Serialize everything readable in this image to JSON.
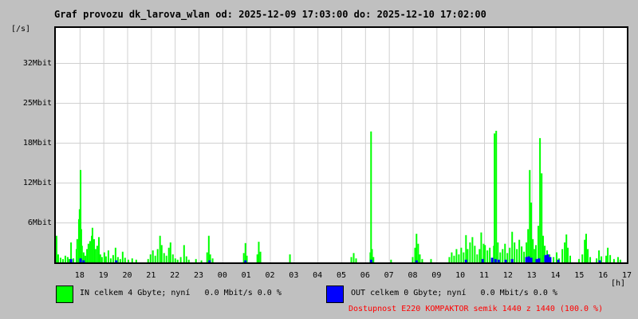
{
  "page": {
    "title": "Graf provozu dk_larova_wlan od: 2025-12-09 17:03:00 do: 2025-12-10 17:02:00",
    "bg_color": "#c0c0c0"
  },
  "axes": {
    "y_unit": "[/s]",
    "x_unit": "[h]"
  },
  "legend": {
    "in": {
      "label": "IN celkem 4 Gbyte; nyní   0.0 Mbit/s 0.0 %",
      "color": "#00ff00"
    },
    "out": {
      "label": "OUT celkem 0 Gbyte; nyní   0.0 Mbit/s 0.0 %",
      "color": "#0000ff"
    }
  },
  "availability": {
    "text": "Dostupnost E220 KOMPAKTOR semik 1440 z 1440 (100.0 %)",
    "color": "#ff0000"
  },
  "chart_data": {
    "type": "area",
    "title": "Graf provozu dk_larova_wlan",
    "period_from": "2025-12-09 17:03:00",
    "period_to": "2025-12-10 17:02:00",
    "xlabel": "[h]",
    "ylabel": "[/s]",
    "grid": true,
    "legend_position": "bottom",
    "x_tick_labels": [
      "18",
      "19",
      "20",
      "21",
      "22",
      "23",
      "00",
      "01",
      "02",
      "03",
      "04",
      "05",
      "06",
      "07",
      "08",
      "09",
      "10",
      "11",
      "12",
      "13",
      "14",
      "15",
      "16",
      "17"
    ],
    "y_tick_labels": [
      "6Mbit",
      "12Mbit",
      "18Mbit",
      "25Mbit",
      "32Mbit"
    ],
    "y_tick_values_mbit": [
      6,
      12,
      18,
      25,
      32
    ],
    "ylim_mbit": [
      0,
      35.3
    ],
    "x_hours_from_17_00": [
      0,
      24
    ],
    "colors": {
      "in": "#00ff00",
      "out": "#0000ff",
      "grid": "#d0d0d0",
      "plot_bg": "#ffffff",
      "frame": "#000000"
    },
    "series": [
      {
        "name": "IN",
        "unit": "Mbit/s",
        "style": "spike-fill",
        "points": [
          [
            0.03,
            4.0
          ],
          [
            0.1,
            1.2
          ],
          [
            0.2,
            0.7
          ],
          [
            0.3,
            0.5
          ],
          [
            0.4,
            1.0
          ],
          [
            0.5,
            0.8
          ],
          [
            0.57,
            0.5
          ],
          [
            0.64,
            3.0
          ],
          [
            0.74,
            0.6
          ],
          [
            0.87,
            2.0
          ],
          [
            0.9,
            3.5
          ],
          [
            0.97,
            6.5
          ],
          [
            1.0,
            8.0
          ],
          [
            1.04,
            13.9
          ],
          [
            1.07,
            5.0
          ],
          [
            1.1,
            2.5
          ],
          [
            1.17,
            1.5
          ],
          [
            1.24,
            1.0
          ],
          [
            1.31,
            2.0
          ],
          [
            1.37,
            2.8
          ],
          [
            1.44,
            3.2
          ],
          [
            1.51,
            4.0
          ],
          [
            1.54,
            5.2
          ],
          [
            1.61,
            3.5
          ],
          [
            1.67,
            2.0
          ],
          [
            1.74,
            2.5
          ],
          [
            1.81,
            3.8
          ],
          [
            1.87,
            1.2
          ],
          [
            1.94,
            0.8
          ],
          [
            2.04,
            1.5
          ],
          [
            2.11,
            0.9
          ],
          [
            2.21,
            1.8
          ],
          [
            2.31,
            0.6
          ],
          [
            2.41,
            1.1
          ],
          [
            2.51,
            2.2
          ],
          [
            2.61,
            0.8
          ],
          [
            2.71,
            0.5
          ],
          [
            2.81,
            1.6
          ],
          [
            2.91,
            0.7
          ],
          [
            3.05,
            0.4
          ],
          [
            3.21,
            0.6
          ],
          [
            3.38,
            0.4
          ],
          [
            3.88,
            0.5
          ],
          [
            3.98,
            1.2
          ],
          [
            4.08,
            1.8
          ],
          [
            4.18,
            1.0
          ],
          [
            4.28,
            2.0
          ],
          [
            4.38,
            4.0
          ],
          [
            4.45,
            2.6
          ],
          [
            4.55,
            1.4
          ],
          [
            4.65,
            1.0
          ],
          [
            4.75,
            2.2
          ],
          [
            4.82,
            3.0
          ],
          [
            4.92,
            1.2
          ],
          [
            5.02,
            0.6
          ],
          [
            5.12,
            0.4
          ],
          [
            5.25,
            0.8
          ],
          [
            5.39,
            2.6
          ],
          [
            5.49,
            0.9
          ],
          [
            5.59,
            0.4
          ],
          [
            5.89,
            0.5
          ],
          [
            6.12,
            0.3
          ],
          [
            6.36,
            1.5
          ],
          [
            6.43,
            4.0
          ],
          [
            6.49,
            1.2
          ],
          [
            6.59,
            0.6
          ],
          [
            7.9,
            1.4
          ],
          [
            7.97,
            2.9
          ],
          [
            8.03,
            1.0
          ],
          [
            8.47,
            1.2
          ],
          [
            8.53,
            3.1
          ],
          [
            8.6,
            1.6
          ],
          [
            9.84,
            1.2
          ],
          [
            12.42,
            0.8
          ],
          [
            12.52,
            1.4
          ],
          [
            12.62,
            0.6
          ],
          [
            13.22,
            1.5
          ],
          [
            13.25,
            19.7
          ],
          [
            13.29,
            2.0
          ],
          [
            13.35,
            0.8
          ],
          [
            14.09,
            0.4
          ],
          [
            15.0,
            0.8
          ],
          [
            15.1,
            2.2
          ],
          [
            15.16,
            4.3
          ],
          [
            15.23,
            2.8
          ],
          [
            15.3,
            1.2
          ],
          [
            15.4,
            0.5
          ],
          [
            15.77,
            0.5
          ],
          [
            16.54,
            0.8
          ],
          [
            16.64,
            1.5
          ],
          [
            16.74,
            1.0
          ],
          [
            16.84,
            2.0
          ],
          [
            16.94,
            1.2
          ],
          [
            17.04,
            2.2
          ],
          [
            17.14,
            1.5
          ],
          [
            17.24,
            4.1
          ],
          [
            17.31,
            2.0
          ],
          [
            17.41,
            3.0
          ],
          [
            17.51,
            3.8
          ],
          [
            17.61,
            2.5
          ],
          [
            17.71,
            1.2
          ],
          [
            17.81,
            2.0
          ],
          [
            17.88,
            4.5
          ],
          [
            17.98,
            2.8
          ],
          [
            18.04,
            2.6
          ],
          [
            18.14,
            1.8
          ],
          [
            18.24,
            2.2
          ],
          [
            18.41,
            2.5
          ],
          [
            18.44,
            19.4
          ],
          [
            18.51,
            19.8
          ],
          [
            18.58,
            3.0
          ],
          [
            18.68,
            1.5
          ],
          [
            18.78,
            2.0
          ],
          [
            18.88,
            2.8
          ],
          [
            18.98,
            1.4
          ],
          [
            19.08,
            2.2
          ],
          [
            19.18,
            4.6
          ],
          [
            19.28,
            3.0
          ],
          [
            19.38,
            2.0
          ],
          [
            19.48,
            3.4
          ],
          [
            19.58,
            2.4
          ],
          [
            19.68,
            1.6
          ],
          [
            19.78,
            3.0
          ],
          [
            19.85,
            5.0
          ],
          [
            19.92,
            13.9
          ],
          [
            19.98,
            9.0
          ],
          [
            20.05,
            3.5
          ],
          [
            20.12,
            2.0
          ],
          [
            20.18,
            2.6
          ],
          [
            20.28,
            5.5
          ],
          [
            20.35,
            18.7
          ],
          [
            20.42,
            13.4
          ],
          [
            20.48,
            4.0
          ],
          [
            20.55,
            2.5
          ],
          [
            20.65,
            1.8
          ],
          [
            20.75,
            1.2
          ],
          [
            20.92,
            0.8
          ],
          [
            21.05,
            1.5
          ],
          [
            21.15,
            0.6
          ],
          [
            21.29,
            2.0
          ],
          [
            21.39,
            3.0
          ],
          [
            21.46,
            4.2
          ],
          [
            21.52,
            2.2
          ],
          [
            21.62,
            1.0
          ],
          [
            21.99,
            0.5
          ],
          [
            22.13,
            1.2
          ],
          [
            22.23,
            3.4
          ],
          [
            22.29,
            4.3
          ],
          [
            22.36,
            2.0
          ],
          [
            22.46,
            0.8
          ],
          [
            22.73,
            0.6
          ],
          [
            22.83,
            1.8
          ],
          [
            22.93,
            0.9
          ],
          [
            23.13,
            1.0
          ],
          [
            23.2,
            2.2
          ],
          [
            23.3,
            1.1
          ],
          [
            23.46,
            0.5
          ],
          [
            23.63,
            0.8
          ],
          [
            23.73,
            0.4
          ]
        ]
      },
      {
        "name": "OUT",
        "unit": "Mbit/s",
        "style": "spike-fill",
        "points": [
          [
            0.64,
            0.5
          ],
          [
            1.04,
            0.6
          ],
          [
            1.17,
            0.3
          ],
          [
            2.54,
            0.3
          ],
          [
            6.46,
            0.3
          ],
          [
            7.97,
            0.3
          ],
          [
            13.25,
            0.4
          ],
          [
            15.16,
            0.3
          ],
          [
            17.24,
            0.4
          ],
          [
            17.94,
            0.5
          ],
          [
            18.34,
            0.7
          ],
          [
            18.48,
            0.5
          ],
          [
            18.61,
            0.4
          ],
          [
            18.91,
            0.4
          ],
          [
            19.18,
            0.5
          ],
          [
            19.78,
            0.8
          ],
          [
            19.88,
            0.9
          ],
          [
            19.98,
            0.7
          ],
          [
            20.21,
            0.5
          ],
          [
            20.31,
            0.6
          ],
          [
            20.58,
            1.1
          ],
          [
            20.68,
            1.2
          ],
          [
            20.78,
            0.8
          ],
          [
            21.12,
            0.4
          ],
          [
            22.86,
            0.3
          ]
        ]
      }
    ]
  }
}
